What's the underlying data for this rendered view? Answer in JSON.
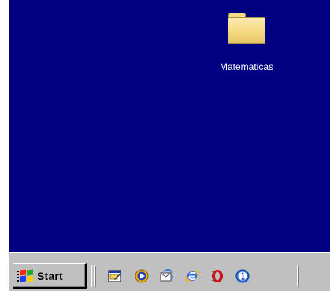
{
  "desktop": {
    "background_color": "#000080",
    "icons": [
      {
        "label": "Matematicas",
        "icon": "folder-icon"
      }
    ]
  },
  "taskbar": {
    "background_color": "#c0c0c0",
    "start_label": "Start",
    "quick_launch": [
      {
        "name": "show-desktop",
        "icon": "show-desktop-icon"
      },
      {
        "name": "media-player",
        "icon": "media-player-icon"
      },
      {
        "name": "outlook-express",
        "icon": "outlook-express-icon"
      },
      {
        "name": "internet-explorer",
        "icon": "internet-explorer-icon"
      },
      {
        "name": "opera",
        "icon": "opera-icon"
      },
      {
        "name": "app-one",
        "icon": "circle-one-icon"
      }
    ]
  }
}
